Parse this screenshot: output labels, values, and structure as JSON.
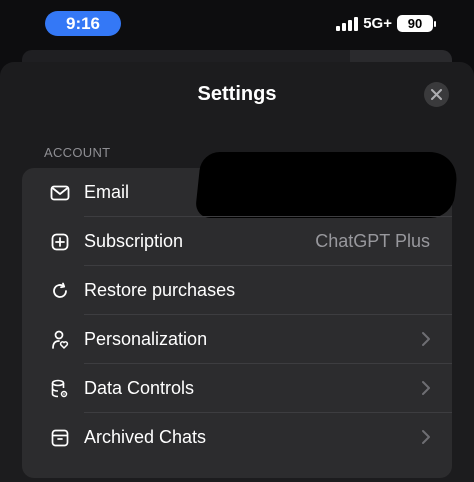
{
  "status_bar": {
    "time": "9:16",
    "network": "5G+",
    "battery": "90"
  },
  "header": {
    "title": "Settings"
  },
  "account": {
    "section_label": "ACCOUNT",
    "rows": [
      {
        "label": "Email",
        "value": "",
        "icon": "mail-icon",
        "chevron": false
      },
      {
        "label": "Subscription",
        "value": "ChatGPT Plus",
        "icon": "plus-square-icon",
        "chevron": false
      },
      {
        "label": "Restore purchases",
        "value": "",
        "icon": "refresh-icon",
        "chevron": false
      },
      {
        "label": "Personalization",
        "value": "",
        "icon": "person-heart-icon",
        "chevron": true
      },
      {
        "label": "Data Controls",
        "value": "",
        "icon": "database-gear-icon",
        "chevron": true
      },
      {
        "label": "Archived Chats",
        "value": "",
        "icon": "archive-icon",
        "chevron": true
      }
    ]
  },
  "colors": {
    "accent": "#3478f6",
    "sheet": "#1c1c1e",
    "group": "#2c2c2e",
    "secondary_text": "#98989d"
  }
}
